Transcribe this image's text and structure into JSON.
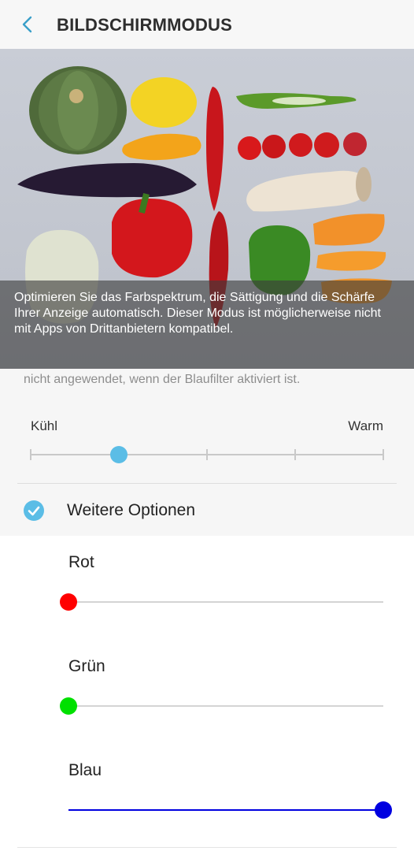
{
  "header": {
    "title": "BILDSCHIRMMODUS",
    "back_icon": "chevron-left-icon"
  },
  "photo": {
    "caption": "Optimieren Sie das Farbspektrum, die Sättigung und die Schärfe Ihrer Anzeige automatisch. Dieser Modus ist möglicherweise nicht mit Apps von Drittanbietern kompatibel."
  },
  "description_partial": "nicht angewendet, wenn der Blaufilter aktiviert ist.",
  "temperature": {
    "cool_label": "Kühl",
    "warm_label": "Warm",
    "value": 0.25,
    "ticks": 5,
    "color": "#5bbde6"
  },
  "more_options": {
    "label": "Weitere Optionen",
    "checked": true,
    "accent": "#5bbde6"
  },
  "colors": [
    {
      "label": "Rot",
      "value": 0.0,
      "color": "#ff0000"
    },
    {
      "label": "Grün",
      "value": 0.0,
      "color": "#00e000"
    },
    {
      "label": "Blau",
      "value": 1.0,
      "color": "#0000e0"
    }
  ]
}
